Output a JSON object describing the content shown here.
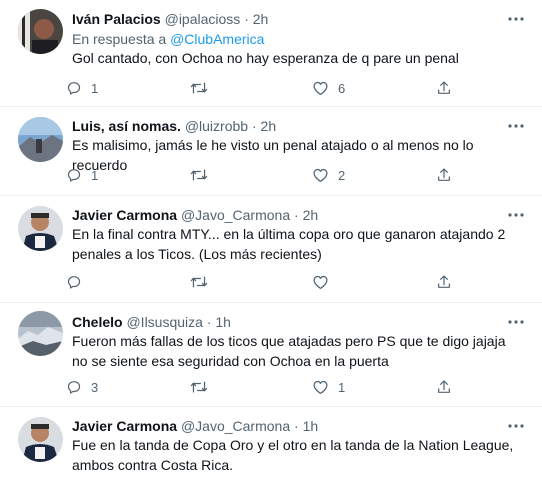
{
  "tweets": [
    {
      "name": "Iván Palacios",
      "handle": "@ipalacioss",
      "sep": "·",
      "time": "2h",
      "reply_prefix": "En respuesta a",
      "reply_mention": "@ClubAmerica",
      "text": "Gol cantado, con Ochoa no hay esperanza de q pare un penal",
      "replies": "1",
      "retweets": "",
      "likes": "6"
    },
    {
      "name": "Luis, así nomas.",
      "handle": "@luizrobb",
      "sep": "·",
      "time": "2h",
      "text": "Es malisimo, jamás le he visto un penal atajado o al menos no lo recuerdo",
      "replies": "1",
      "retweets": "",
      "likes": "2"
    },
    {
      "name": "Javier Carmona",
      "handle": "@Javo_Carmona",
      "sep": "·",
      "time": "2h",
      "text": "En la final contra MTY... en la última copa oro que ganaron atajando 2 penales a los Ticos. (Los más recientes)",
      "replies": "",
      "retweets": "",
      "likes": ""
    },
    {
      "name": "Chelelo",
      "handle": "@Ilsusquiza",
      "sep": "·",
      "time": "1h",
      "text": "Fueron más fallas de los ticos que atajadas pero PS que te digo jajaja no se siente esa seguridad con Ochoa en la puerta",
      "replies": "3",
      "retweets": "",
      "likes": "1"
    },
    {
      "name": "Javier Carmona",
      "handle": "@Javo_Carmona",
      "sep": "·",
      "time": "1h",
      "text": "Fue en la tanda de Copa Oro y el otro en la tanda de la Nation League, ambos contra Costa Rica.",
      "replies": "",
      "retweets": "",
      "likes": ""
    }
  ],
  "icons": {
    "more": "more-horizontal-icon",
    "reply": "reply-icon",
    "retweet": "retweet-icon",
    "like": "heart-icon",
    "share": "share-icon"
  },
  "colors": {
    "text": "#0f1419",
    "secondary": "#536471",
    "link": "#1d9bf0",
    "divider": "#eff3f4"
  }
}
